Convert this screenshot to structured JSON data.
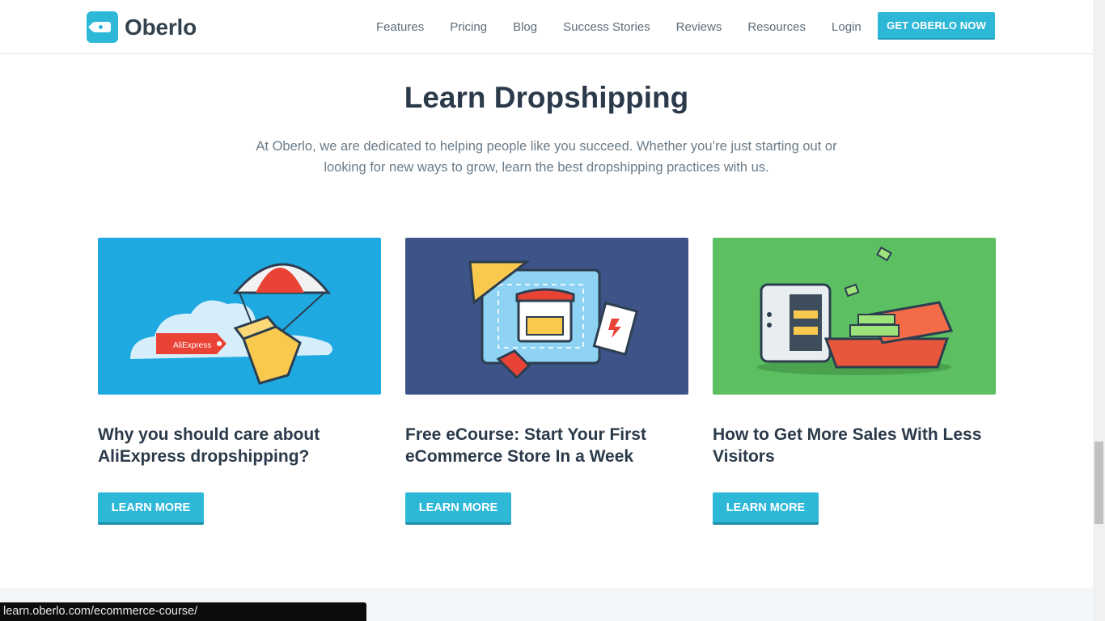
{
  "header": {
    "logo_text": "Oberlo",
    "nav": [
      "Features",
      "Pricing",
      "Blog",
      "Success Stories",
      "Reviews",
      "Resources",
      "Login"
    ],
    "cta": "GET OBERLO NOW"
  },
  "hero": {
    "title": "Learn Dropshipping",
    "intro": "At Oberlo, we are dedicated to helping people like you succeed. Whether you’re just starting out or looking for new ways to grow, learn the best dropshipping practices with us."
  },
  "cards": [
    {
      "title": "Why you should care about AliExpress dropshipping?",
      "button": "LEARN MORE",
      "image_label": "AliExpress",
      "image_color": "#1fa9e1"
    },
    {
      "title": "Free eCourse: Start Your First eCommerce Store In a Week",
      "button": "LEARN MORE",
      "image_color": "#3e5488"
    },
    {
      "title": "How to Get More Sales With Less Visitors",
      "button": "LEARN MORE",
      "image_color": "#5cc062"
    }
  ],
  "status_bar": {
    "url": "learn.oberlo.com/ecommerce-course/"
  },
  "colors": {
    "accent": "#2eb8d8",
    "heading": "#2b3a4a",
    "body_text": "#6a7b88"
  }
}
